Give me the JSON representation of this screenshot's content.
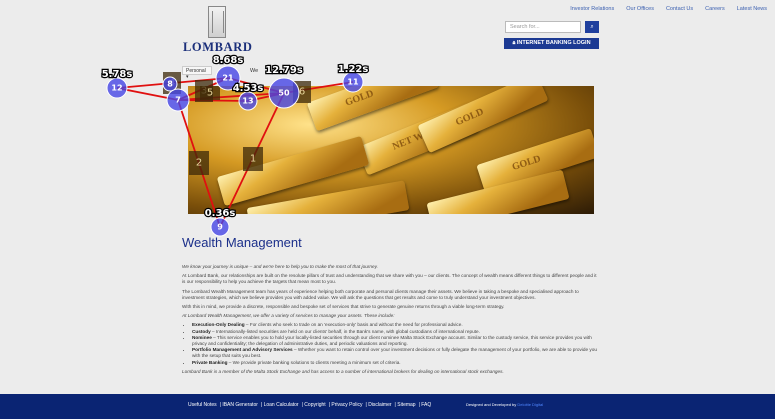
{
  "header": {
    "top_links": [
      "Investor Relations",
      "Our Offices",
      "Contact Us",
      "Careers",
      "Latest News"
    ],
    "logo_text": "LOMBARD",
    "search_placeholder": "Search for...",
    "search_icon": "search-icon",
    "login_label": "INTERNET BANKING LOGIN",
    "login_icon": "lock-icon"
  },
  "nav": {
    "personal_label": "Personal ▾",
    "wealth_label": "We"
  },
  "hero": {
    "bar_texts": [
      "GOLD",
      "NET WT 2009",
      "GOLD",
      "GOLD"
    ]
  },
  "page": {
    "title": "Wealth Management",
    "intro": "We know your journey is unique – and we're here to help you to make the most of that journey.",
    "p1": "At Lombard Bank, our relationships are built on the resolute pillars of trust and understanding that we share with you – our clients. The concept of wealth means different things to different people and it is our responsibility to help you achieve the targets that mean most to you.",
    "p2": "The Lombard Wealth Management team has years of experience helping both corporate and personal clients manage their assets. We believe in taking a bespoke and specialised approach to investment strategies, which we believe provides you with added value. We will ask the questions that get results and come to truly understand your investment objectives.",
    "p3": "With this in mind, we provide a discrete, responsible and bespoke set of services that strive to generate genuine returns through a viable long-term strategy.",
    "services_intro": "At Lombard Wealth Management, we offer a variety of services to manage your assets. These include:",
    "services": [
      {
        "name": "Execution-Only Dealing",
        "text": " – For clients who seek to trade on an 'execution-only' basis and without the need for professional advice."
      },
      {
        "name": "Custody",
        "text": " – Internationally-listed securities are held on our clients' behalf, in the Bank's name, with global custodians of international repute."
      },
      {
        "name": "Nominee",
        "text": " – This service enables you to hold your locally-listed securities through our client nominee Malta Stock Exchange account. Similar to the custody service, this service provides you with privacy and confidentiality; the delegation of administrative duties, and periodic valuations and reporting."
      },
      {
        "name": "Portfolio Management and Advisory Services",
        "text": " – Whether you want to retain control over your investment decisions or fully delegate the management of your portfolio, we are able to provide you with the setup that suits you best."
      },
      {
        "name": "Private Banking",
        "text": " – We provide private banking solutions to clients meeting a minimum set of criteria."
      }
    ],
    "closing": "Lombard Bank is a member of the Malta Stock Exchange and has access to a number of international brokers for dealing on international stock exchanges."
  },
  "footer": {
    "links": [
      "Useful Notes",
      "| IBAN Generator",
      "| Loan Calculator",
      "| Copyright",
      "| Privacy Policy",
      "| Disclaimer",
      "| Sitemap",
      "| FAQ"
    ],
    "credit_prefix": "Designed and Developed by ",
    "credit_name": "Deloitte Digital"
  },
  "overlay": {
    "fixations": [
      {
        "id": "12",
        "duration": "5.78s"
      },
      {
        "id": "21",
        "duration": "8.68s"
      },
      {
        "id": "13",
        "duration": "4.53s"
      },
      {
        "id": "50",
        "duration": "12.79s"
      },
      {
        "id": "11",
        "duration": "1.22s"
      },
      {
        "id": "9",
        "duration": "0.36s"
      },
      {
        "id": "7",
        "duration": ""
      },
      {
        "id": "8",
        "duration": ""
      }
    ],
    "aoi_labels": [
      "1",
      "2",
      "3",
      "4",
      "5",
      "6",
      "6"
    ]
  }
}
